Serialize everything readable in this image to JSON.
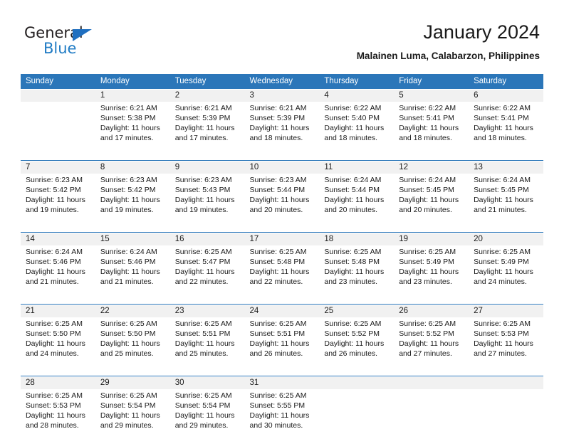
{
  "brand": {
    "name_part1": "General",
    "name_part2": "Blue",
    "triangle_icon": "triangle-icon",
    "color_primary": "#1f7bc4",
    "color_text": "#231f20"
  },
  "header": {
    "title": "January 2024",
    "subtitle": "Malainen Luma, Calabarzon, Philippines"
  },
  "calendar": {
    "header_bg": "#2b76b9",
    "daynum_bg": "#f1f1f1",
    "weekdays": [
      "Sunday",
      "Monday",
      "Tuesday",
      "Wednesday",
      "Thursday",
      "Friday",
      "Saturday"
    ],
    "weeks": [
      {
        "days": [
          {
            "num": "",
            "sunrise": "",
            "sunset": "",
            "daylight1": "",
            "daylight2": ""
          },
          {
            "num": "1",
            "sunrise": "Sunrise: 6:21 AM",
            "sunset": "Sunset: 5:38 PM",
            "daylight1": "Daylight: 11 hours",
            "daylight2": "and 17 minutes."
          },
          {
            "num": "2",
            "sunrise": "Sunrise: 6:21 AM",
            "sunset": "Sunset: 5:39 PM",
            "daylight1": "Daylight: 11 hours",
            "daylight2": "and 17 minutes."
          },
          {
            "num": "3",
            "sunrise": "Sunrise: 6:21 AM",
            "sunset": "Sunset: 5:39 PM",
            "daylight1": "Daylight: 11 hours",
            "daylight2": "and 18 minutes."
          },
          {
            "num": "4",
            "sunrise": "Sunrise: 6:22 AM",
            "sunset": "Sunset: 5:40 PM",
            "daylight1": "Daylight: 11 hours",
            "daylight2": "and 18 minutes."
          },
          {
            "num": "5",
            "sunrise": "Sunrise: 6:22 AM",
            "sunset": "Sunset: 5:41 PM",
            "daylight1": "Daylight: 11 hours",
            "daylight2": "and 18 minutes."
          },
          {
            "num": "6",
            "sunrise": "Sunrise: 6:22 AM",
            "sunset": "Sunset: 5:41 PM",
            "daylight1": "Daylight: 11 hours",
            "daylight2": "and 18 minutes."
          }
        ]
      },
      {
        "days": [
          {
            "num": "7",
            "sunrise": "Sunrise: 6:23 AM",
            "sunset": "Sunset: 5:42 PM",
            "daylight1": "Daylight: 11 hours",
            "daylight2": "and 19 minutes."
          },
          {
            "num": "8",
            "sunrise": "Sunrise: 6:23 AM",
            "sunset": "Sunset: 5:42 PM",
            "daylight1": "Daylight: 11 hours",
            "daylight2": "and 19 minutes."
          },
          {
            "num": "9",
            "sunrise": "Sunrise: 6:23 AM",
            "sunset": "Sunset: 5:43 PM",
            "daylight1": "Daylight: 11 hours",
            "daylight2": "and 19 minutes."
          },
          {
            "num": "10",
            "sunrise": "Sunrise: 6:23 AM",
            "sunset": "Sunset: 5:44 PM",
            "daylight1": "Daylight: 11 hours",
            "daylight2": "and 20 minutes."
          },
          {
            "num": "11",
            "sunrise": "Sunrise: 6:24 AM",
            "sunset": "Sunset: 5:44 PM",
            "daylight1": "Daylight: 11 hours",
            "daylight2": "and 20 minutes."
          },
          {
            "num": "12",
            "sunrise": "Sunrise: 6:24 AM",
            "sunset": "Sunset: 5:45 PM",
            "daylight1": "Daylight: 11 hours",
            "daylight2": "and 20 minutes."
          },
          {
            "num": "13",
            "sunrise": "Sunrise: 6:24 AM",
            "sunset": "Sunset: 5:45 PM",
            "daylight1": "Daylight: 11 hours",
            "daylight2": "and 21 minutes."
          }
        ]
      },
      {
        "days": [
          {
            "num": "14",
            "sunrise": "Sunrise: 6:24 AM",
            "sunset": "Sunset: 5:46 PM",
            "daylight1": "Daylight: 11 hours",
            "daylight2": "and 21 minutes."
          },
          {
            "num": "15",
            "sunrise": "Sunrise: 6:24 AM",
            "sunset": "Sunset: 5:46 PM",
            "daylight1": "Daylight: 11 hours",
            "daylight2": "and 21 minutes."
          },
          {
            "num": "16",
            "sunrise": "Sunrise: 6:25 AM",
            "sunset": "Sunset: 5:47 PM",
            "daylight1": "Daylight: 11 hours",
            "daylight2": "and 22 minutes."
          },
          {
            "num": "17",
            "sunrise": "Sunrise: 6:25 AM",
            "sunset": "Sunset: 5:48 PM",
            "daylight1": "Daylight: 11 hours",
            "daylight2": "and 22 minutes."
          },
          {
            "num": "18",
            "sunrise": "Sunrise: 6:25 AM",
            "sunset": "Sunset: 5:48 PM",
            "daylight1": "Daylight: 11 hours",
            "daylight2": "and 23 minutes."
          },
          {
            "num": "19",
            "sunrise": "Sunrise: 6:25 AM",
            "sunset": "Sunset: 5:49 PM",
            "daylight1": "Daylight: 11 hours",
            "daylight2": "and 23 minutes."
          },
          {
            "num": "20",
            "sunrise": "Sunrise: 6:25 AM",
            "sunset": "Sunset: 5:49 PM",
            "daylight1": "Daylight: 11 hours",
            "daylight2": "and 24 minutes."
          }
        ]
      },
      {
        "days": [
          {
            "num": "21",
            "sunrise": "Sunrise: 6:25 AM",
            "sunset": "Sunset: 5:50 PM",
            "daylight1": "Daylight: 11 hours",
            "daylight2": "and 24 minutes."
          },
          {
            "num": "22",
            "sunrise": "Sunrise: 6:25 AM",
            "sunset": "Sunset: 5:50 PM",
            "daylight1": "Daylight: 11 hours",
            "daylight2": "and 25 minutes."
          },
          {
            "num": "23",
            "sunrise": "Sunrise: 6:25 AM",
            "sunset": "Sunset: 5:51 PM",
            "daylight1": "Daylight: 11 hours",
            "daylight2": "and 25 minutes."
          },
          {
            "num": "24",
            "sunrise": "Sunrise: 6:25 AM",
            "sunset": "Sunset: 5:51 PM",
            "daylight1": "Daylight: 11 hours",
            "daylight2": "and 26 minutes."
          },
          {
            "num": "25",
            "sunrise": "Sunrise: 6:25 AM",
            "sunset": "Sunset: 5:52 PM",
            "daylight1": "Daylight: 11 hours",
            "daylight2": "and 26 minutes."
          },
          {
            "num": "26",
            "sunrise": "Sunrise: 6:25 AM",
            "sunset": "Sunset: 5:52 PM",
            "daylight1": "Daylight: 11 hours",
            "daylight2": "and 27 minutes."
          },
          {
            "num": "27",
            "sunrise": "Sunrise: 6:25 AM",
            "sunset": "Sunset: 5:53 PM",
            "daylight1": "Daylight: 11 hours",
            "daylight2": "and 27 minutes."
          }
        ]
      },
      {
        "days": [
          {
            "num": "28",
            "sunrise": "Sunrise: 6:25 AM",
            "sunset": "Sunset: 5:53 PM",
            "daylight1": "Daylight: 11 hours",
            "daylight2": "and 28 minutes."
          },
          {
            "num": "29",
            "sunrise": "Sunrise: 6:25 AM",
            "sunset": "Sunset: 5:54 PM",
            "daylight1": "Daylight: 11 hours",
            "daylight2": "and 29 minutes."
          },
          {
            "num": "30",
            "sunrise": "Sunrise: 6:25 AM",
            "sunset": "Sunset: 5:54 PM",
            "daylight1": "Daylight: 11 hours",
            "daylight2": "and 29 minutes."
          },
          {
            "num": "31",
            "sunrise": "Sunrise: 6:25 AM",
            "sunset": "Sunset: 5:55 PM",
            "daylight1": "Daylight: 11 hours",
            "daylight2": "and 30 minutes."
          },
          {
            "num": "",
            "sunrise": "",
            "sunset": "",
            "daylight1": "",
            "daylight2": ""
          },
          {
            "num": "",
            "sunrise": "",
            "sunset": "",
            "daylight1": "",
            "daylight2": ""
          },
          {
            "num": "",
            "sunrise": "",
            "sunset": "",
            "daylight1": "",
            "daylight2": ""
          }
        ]
      }
    ]
  }
}
